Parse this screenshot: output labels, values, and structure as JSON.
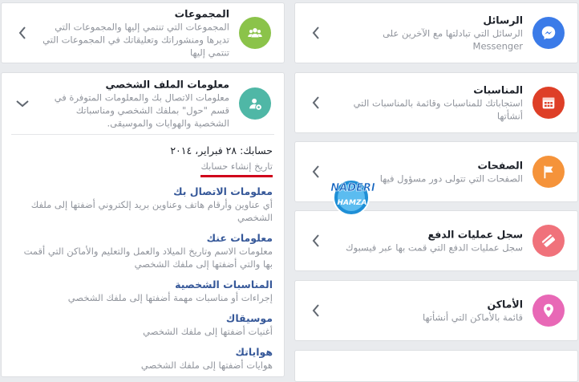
{
  "right_cards": {
    "messages": {
      "title": "الرسائل",
      "desc": "الرسائل التي تبادلتها مع الآخرين على Messenger",
      "color": "#3b7be8",
      "icon": "messenger-icon"
    },
    "events": {
      "title": "المناسبات",
      "desc": "استجاباتك للمناسبات وقائمة بالمناسبات التي أنشأتها",
      "color": "#de3f27",
      "icon": "calendar-icon"
    },
    "pages": {
      "title": "الصفحات",
      "desc": "الصفحات التي تتولى دور مسؤول فيها",
      "color": "#f5933a",
      "icon": "flag-icon"
    },
    "payments": {
      "title": "سجل عمليات الدفع",
      "desc": "سجل عمليات الدفع التي قمت بها عبر فيسبوك",
      "color": "#f0727b",
      "icon": "card-icon"
    },
    "places": {
      "title": "الأماكن",
      "desc": "قائمة بالأماكن التي أنشأتها",
      "color": "#e868b6",
      "icon": "location-pin-icon"
    }
  },
  "groups": {
    "title": "المجموعات",
    "desc": "المجموعات التي تنتمي إليها والمجموعات التي تديرها ومنشوراتك وتعليقاتك في المجموعات التي تنتمي إليها",
    "color": "#8bc34a",
    "icon": "groups-icon"
  },
  "profile": {
    "title": "معلومات الملف الشخصي",
    "desc": "معلومات الاتصال بك والمعلومات المتوفرة في قسم \"حول\" بملفك الشخصي ومناسباتك الشخصية والهوايات والموسيقى.",
    "color": "#4fb7a6",
    "icon": "profile-settings-icon",
    "joined": "حسابك: ٢٨ فبراير، ٢٠١٤",
    "joined_sub": "تاريخ إنشاء حسابك",
    "sections": [
      {
        "title": "معلومات الاتصال بك",
        "desc": "أي عناوين وأرقام هاتف وعناوين بريد إلكتروني أضفتها إلى ملفك الشخصي"
      },
      {
        "title": "معلومات عنك",
        "desc": "معلومات الاسم وتاريخ الميلاد والعمل والتعليم والأماكن التي أقمت بها والتي أضفتها إلى ملفك الشخصي"
      },
      {
        "title": "المناسبات الشخصية",
        "desc": "إجراءات أو مناسبات مهمة أضفتها إلى ملفك الشخصي"
      },
      {
        "title": "موسيقاك",
        "desc": "أغنيات أضفتها إلى ملفك الشخصي"
      },
      {
        "title": "هواياتك",
        "desc": "هوايات أضفتها إلى ملفك الشخصي"
      }
    ]
  },
  "watermark": {
    "line1": "NADERI",
    "line2": "HAMZA"
  }
}
